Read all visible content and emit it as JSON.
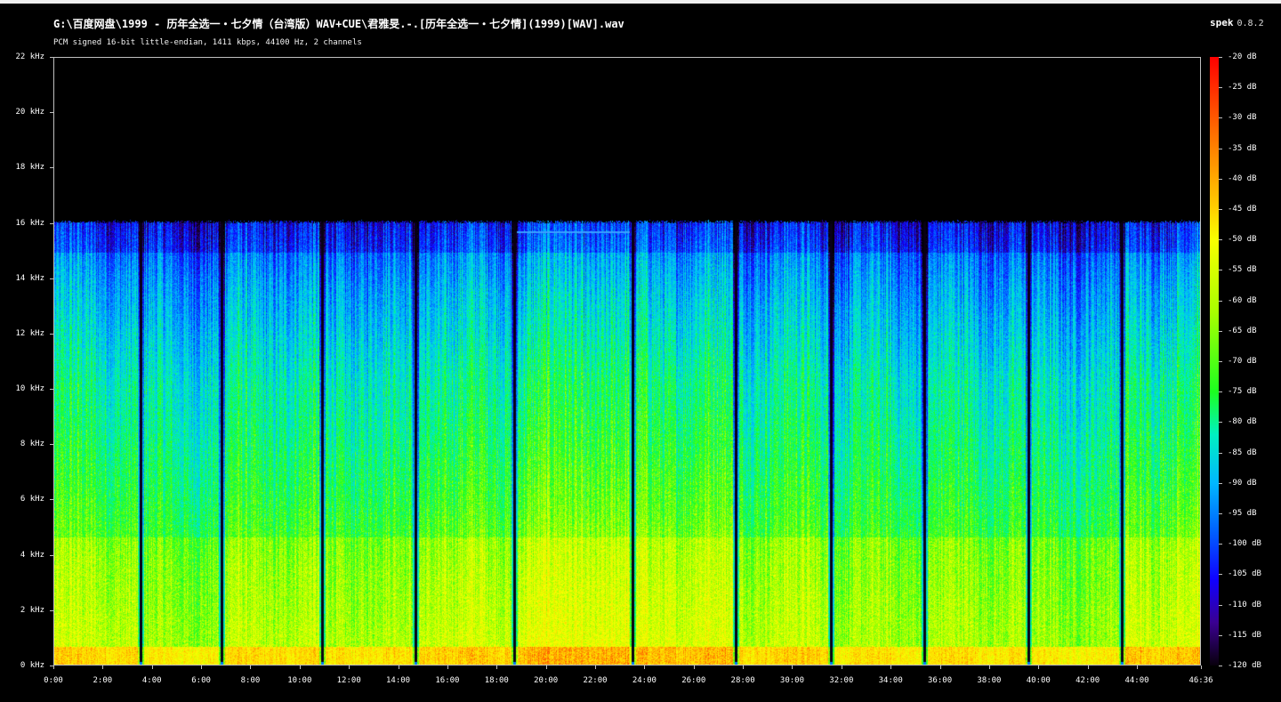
{
  "window": {
    "title": "G:\\百度网盘\\1999 - 历年全选一・七夕情（台湾版）WAV+CUE\\君雅旻.-.[历年全选一・七夕情](1999)[WAV].wav",
    "subtitle": "PCM signed 16-bit little-endian, 1411 kbps, 44100 Hz, 2 channels",
    "app_name": "spek",
    "app_version": "0.8.2"
  },
  "chart_data": {
    "type": "heatmap",
    "title": "G:\\百度网盘\\1999 - 历年全选一・七夕情（台湾版）WAV+CUE\\君雅旻.-.[历年全选一・七夕情](1999)[WAV].wav",
    "xlabel": "",
    "ylabel": "",
    "x_range_seconds": [
      0,
      2796
    ],
    "y_range_khz": [
      0,
      22
    ],
    "x_ticks": [
      "0:00",
      "2:00",
      "4:00",
      "6:00",
      "8:00",
      "10:00",
      "12:00",
      "14:00",
      "16:00",
      "18:00",
      "20:00",
      "22:00",
      "24:00",
      "26:00",
      "28:00",
      "30:00",
      "32:00",
      "34:00",
      "36:00",
      "38:00",
      "40:00",
      "42:00",
      "44:00",
      "46:36"
    ],
    "y_ticks": [
      "0 kHz",
      "2 kHz",
      "4 kHz",
      "6 kHz",
      "8 kHz",
      "10 kHz",
      "12 kHz",
      "14 kHz",
      "16 kHz",
      "18 kHz",
      "20 kHz",
      "22 kHz"
    ],
    "db_range": [
      -120,
      -20
    ],
    "db_ticks": [
      "-20 dB",
      "-25 dB",
      "-30 dB",
      "-35 dB",
      "-40 dB",
      "-45 dB",
      "-50 dB",
      "-55 dB",
      "-60 dB",
      "-65 dB",
      "-70 dB",
      "-75 dB",
      "-80 dB",
      "-85 dB",
      "-90 dB",
      "-95 dB",
      "-100 dB",
      "-105 dB",
      "-110 dB",
      "-115 dB",
      "-120 dB"
    ],
    "lowpass_cutoff_khz": 16,
    "track_boundaries_min": [
      3.5,
      6.8,
      10.9,
      14.7,
      18.7,
      23.5,
      27.7,
      31.6,
      35.4,
      39.6,
      43.4
    ],
    "colormap": [
      "#000000",
      "#2a0060",
      "#1000ff",
      "#0060ff",
      "#00b8ff",
      "#00f0c0",
      "#1cff20",
      "#a8ff00",
      "#f8ff00",
      "#ffd000",
      "#ff6a00",
      "#ff0000"
    ]
  }
}
